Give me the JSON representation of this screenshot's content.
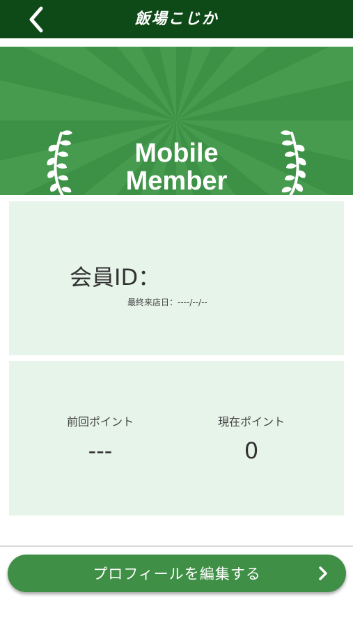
{
  "header": {
    "title": "飯場こじか",
    "back_icon": "chevron-left-icon"
  },
  "banner": {
    "title_line1": "Mobile",
    "title_line2": "Member",
    "left_icon": "laurel-icon",
    "right_icon": "laurel-icon",
    "colors": {
      "background": "#3d9146",
      "rays": "#4fa457"
    }
  },
  "member_card": {
    "id_label": "会員ID：",
    "id_value": "",
    "last_visit_label": "最終来店日：",
    "last_visit_value": "----/--/--"
  },
  "points_card": {
    "previous_label": "前回ポイント",
    "previous_value": "---",
    "current_label": "現在ポイント",
    "current_value": "0"
  },
  "actions": {
    "edit_profile_label": "プロフィールを編集する",
    "edit_profile_icon": "chevron-right-icon"
  },
  "colors": {
    "header": "#0e4a17",
    "card_bg": "#e7f4ea",
    "button": "#3f8f46"
  }
}
